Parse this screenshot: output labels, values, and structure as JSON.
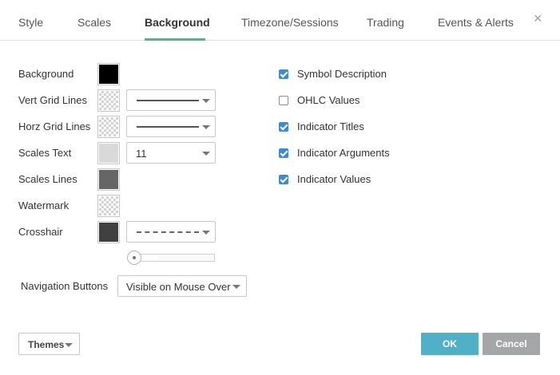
{
  "tabs": [
    {
      "label": "Style"
    },
    {
      "label": "Scales"
    },
    {
      "label": "Background",
      "active": true
    },
    {
      "label": "Timezone/Sessions"
    },
    {
      "label": "Trading"
    },
    {
      "label": "Events & Alerts"
    }
  ],
  "close_icon": "×",
  "settings": {
    "background": {
      "label": "Background",
      "color": "#000000"
    },
    "vert_grid_lines": {
      "label": "Vert Grid Lines",
      "color": "transparent",
      "line_style": "solid"
    },
    "horz_grid_lines": {
      "label": "Horz Grid Lines",
      "color": "transparent",
      "line_style": "solid"
    },
    "scales_text": {
      "label": "Scales Text",
      "color": "#d9d9d9",
      "font_size": "11"
    },
    "scales_lines": {
      "label": "Scales Lines",
      "color": "#666666"
    },
    "watermark": {
      "label": "Watermark",
      "color": "transparent"
    },
    "crosshair": {
      "label": "Crosshair",
      "color": "#404040",
      "line_style": "dashed",
      "opacity": 0
    }
  },
  "navigation": {
    "label": "Navigation Buttons",
    "value": "Visible on Mouse Over"
  },
  "checkboxes": [
    {
      "label": "Symbol Description",
      "checked": true
    },
    {
      "label": "OHLC Values",
      "checked": false
    },
    {
      "label": "Indicator Titles",
      "checked": true
    },
    {
      "label": "Indicator Arguments",
      "checked": true
    },
    {
      "label": "Indicator Values",
      "checked": true
    }
  ],
  "footer": {
    "themes_label": "Themes",
    "ok_label": "OK",
    "cancel_label": "Cancel"
  },
  "colors": {
    "accent": "#6aa88e",
    "ok": "#4fb0c6",
    "cancel": "#a4a6a8",
    "checkbox": "#3d8bd8"
  }
}
